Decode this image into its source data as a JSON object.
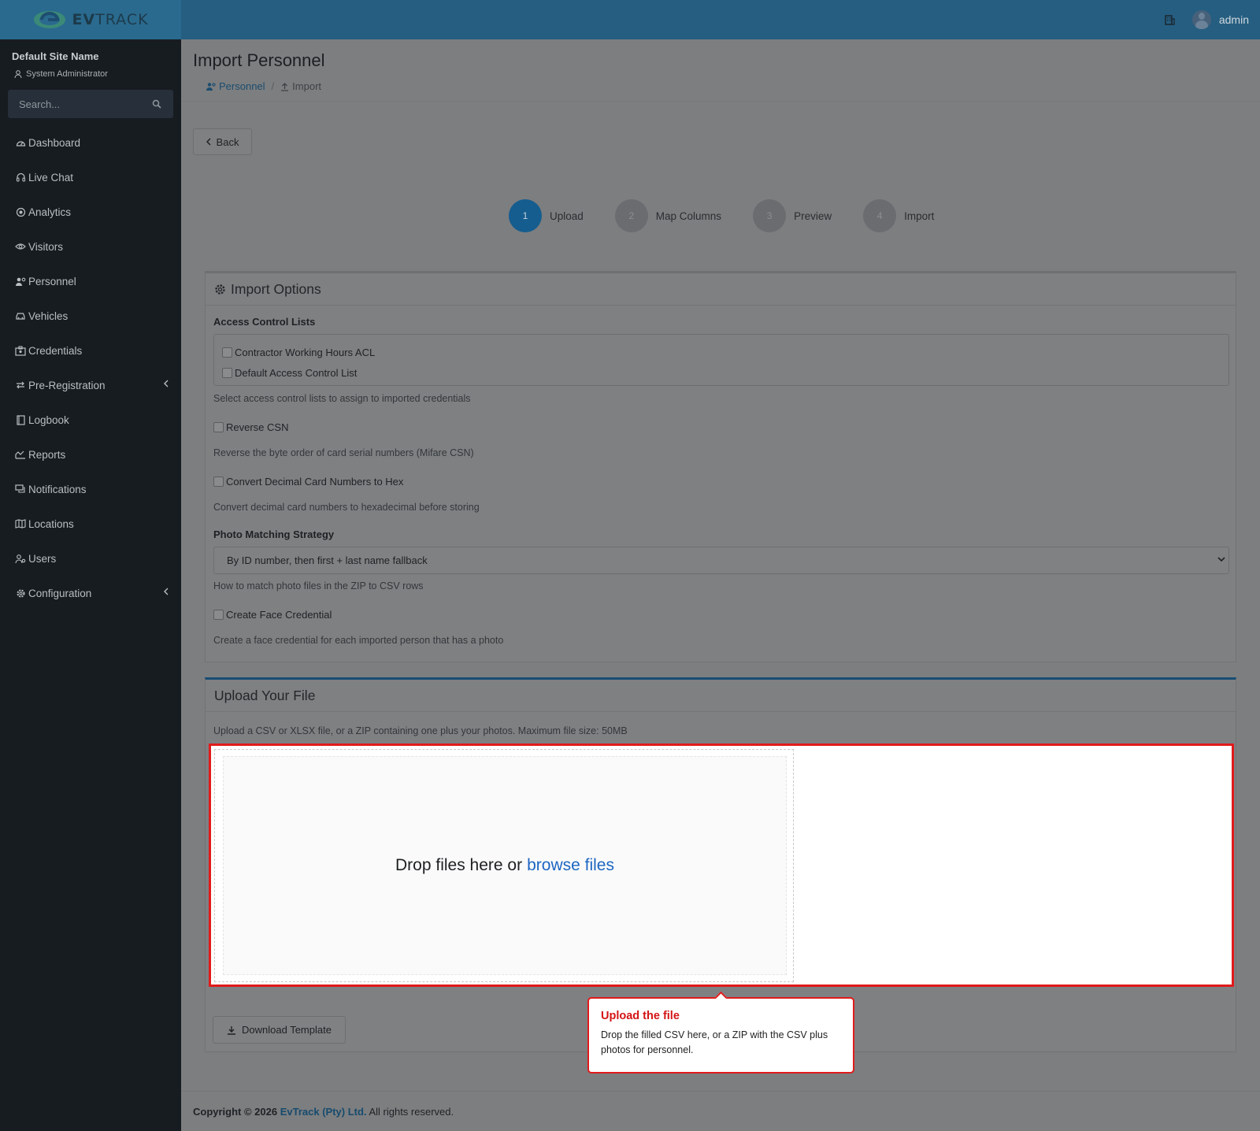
{
  "app": {
    "brand_prefix": "EV",
    "brand_suffix": "TRACK",
    "user": "admin"
  },
  "sidebar": {
    "site_name": "Default Site Name",
    "role": "System Administrator",
    "search_placeholder": "Search...",
    "items": [
      {
        "label": "Dashboard",
        "icon": "gauge-icon"
      },
      {
        "label": "Live Chat",
        "icon": "headset-icon"
      },
      {
        "label": "Analytics",
        "icon": "target-icon"
      },
      {
        "label": "Visitors",
        "icon": "eye-icon"
      },
      {
        "label": "Personnel",
        "icon": "user-gear-icon"
      },
      {
        "label": "Vehicles",
        "icon": "car-icon"
      },
      {
        "label": "Credentials",
        "icon": "id-badge-icon"
      },
      {
        "label": "Pre-Registration",
        "icon": "arrows-icon",
        "submenu": true
      },
      {
        "label": "Logbook",
        "icon": "book-icon"
      },
      {
        "label": "Reports",
        "icon": "chart-icon"
      },
      {
        "label": "Notifications",
        "icon": "chat-icon"
      },
      {
        "label": "Locations",
        "icon": "map-icon"
      },
      {
        "label": "Users",
        "icon": "users-gear-icon"
      },
      {
        "label": "Configuration",
        "icon": "gear-icon",
        "submenu": true
      }
    ]
  },
  "page": {
    "title": "Import Personnel",
    "breadcrumb": {
      "parent": "Personnel",
      "sep": "/",
      "current": "Import"
    },
    "back_label": "Back"
  },
  "steps": [
    {
      "num": "1",
      "label": "Upload",
      "active": true
    },
    {
      "num": "2",
      "label": "Map Columns",
      "active": false
    },
    {
      "num": "3",
      "label": "Preview",
      "active": false
    },
    {
      "num": "4",
      "label": "Import",
      "active": false
    }
  ],
  "import_options": {
    "title": "Import Options",
    "acl_label": "Access Control Lists",
    "acl_items": [
      "Contractor Working Hours ACL",
      "Default Access Control List"
    ],
    "acl_help": "Select access control lists to assign to imported credentials",
    "reverse_csn_label": "Reverse CSN",
    "reverse_csn_help": "Reverse the byte order of card serial numbers (Mifare CSN)",
    "convert_hex_label": "Convert Decimal Card Numbers to Hex",
    "convert_hex_help": "Convert decimal card numbers to hexadecimal before storing",
    "photo_label": "Photo Matching Strategy",
    "photo_value": "By ID number, then first + last name fallback",
    "photo_help": "How to match photo files in the ZIP to CSV rows",
    "face_label": "Create Face Credential",
    "face_help": "Create a face credential for each imported person that has a photo"
  },
  "upload": {
    "title": "Upload Your File",
    "hint": "Upload a CSV or XLSX file, or a ZIP containing one plus your photos. Maximum file size: 50MB",
    "drop_text": "Drop files here or",
    "browse_text": "browse files",
    "download_label": "Download Template"
  },
  "tooltip": {
    "title": "Upload the file",
    "text": "Drop the filled CSV here, or a ZIP with the CSV plus photos for personnel."
  },
  "footer": {
    "copyright": "Copyright © 2026",
    "company": "EvTrack (Pty) Ltd.",
    "rights": "All rights reserved."
  },
  "colors": {
    "topbar": "#255e80",
    "sidebar": "#171c21",
    "accent": "#155d8f",
    "highlight": "#e01b1b",
    "link": "#1d66c2"
  }
}
